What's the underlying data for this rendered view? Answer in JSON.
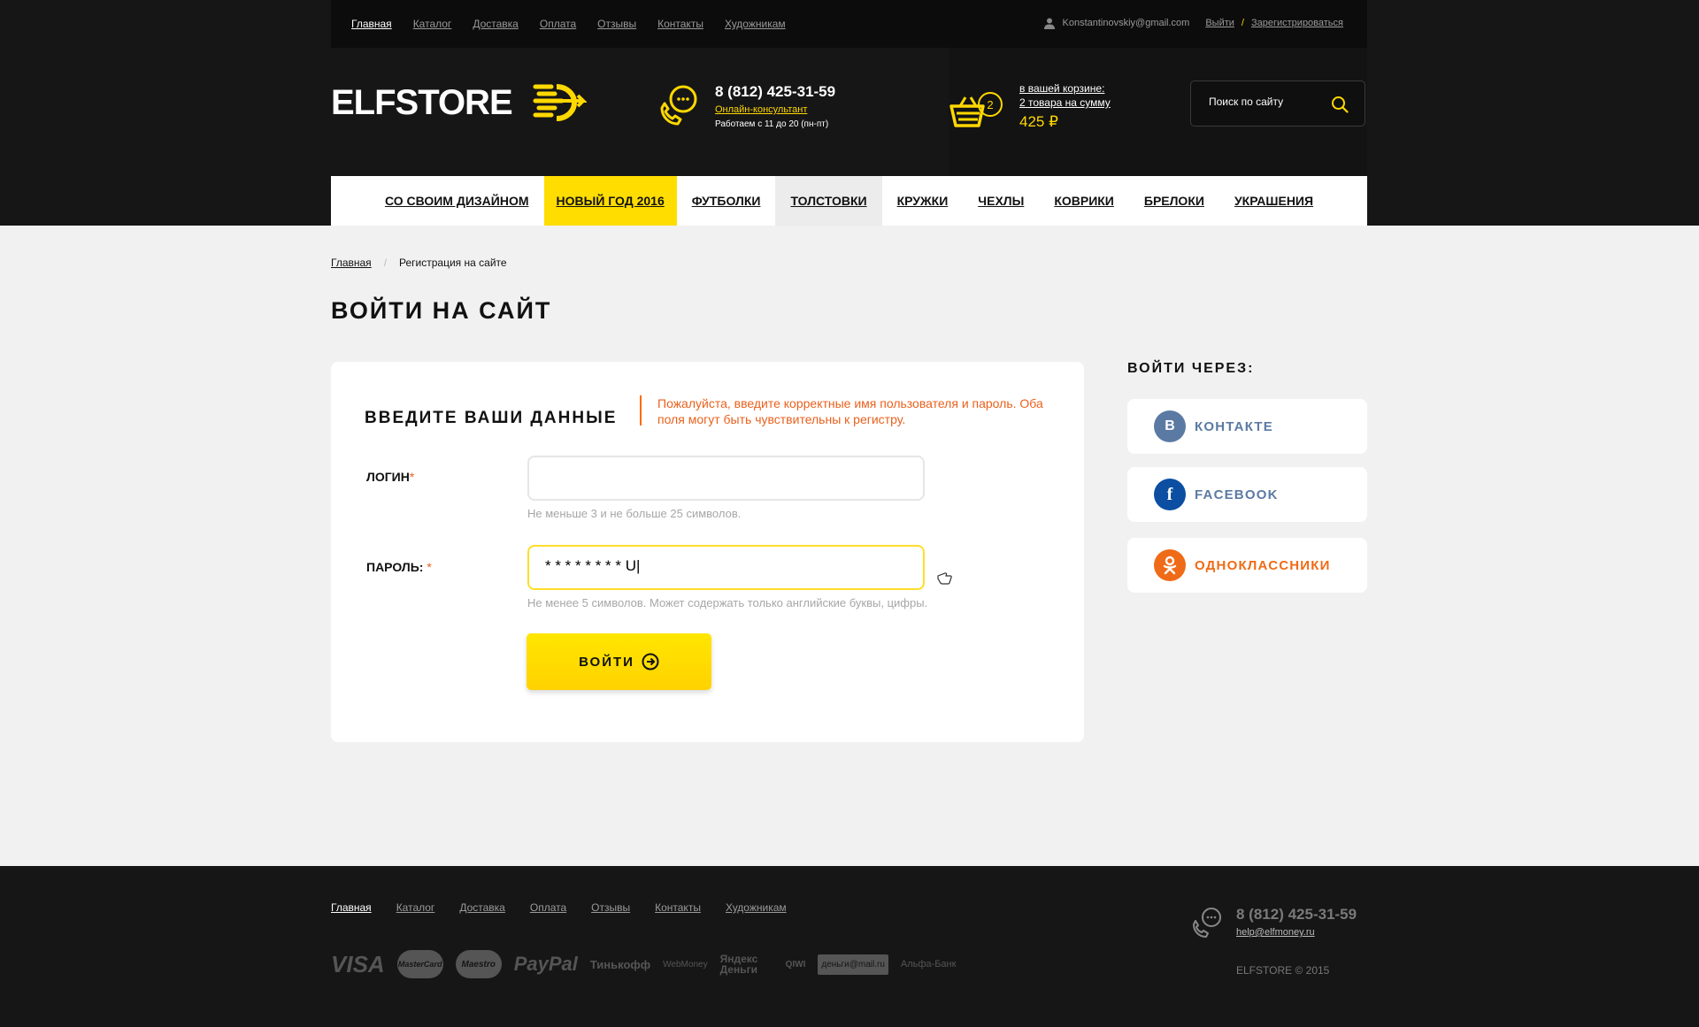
{
  "top_nav": {
    "items": [
      "Главная",
      "Каталог",
      "Доставка",
      "Оплата",
      "Отзывы",
      "Контакты",
      "Художникам"
    ],
    "active": "Главная"
  },
  "user": {
    "email": "Konstantinovskiy@gmail.com",
    "logout": "Выйти",
    "separator": "/",
    "register": "Зарегистрироваться"
  },
  "brand": {
    "name": "ELFSTORE",
    "accent": "#ffd800"
  },
  "contact": {
    "phone": "8 (812) 425-31-59",
    "consultant": "Онлайн-консультант",
    "hours": "Работаем с 11 до 20 (пн-пт)"
  },
  "cart": {
    "count": "2",
    "line1": "в вашей корзине:",
    "line2": "2 товара на сумму",
    "sum": "425 ₽"
  },
  "search": {
    "placeholder": "Поиск по сайту"
  },
  "categories": [
    "СО СВОИМ ДИЗАЙНОМ",
    "НОВЫЙ ГОД 2016",
    "ФУТБОЛКИ",
    "ТОЛСТОВКИ",
    "КРУЖКИ",
    "ЧЕХЛЫ",
    "КОВРИКИ",
    "БРЕЛОКИ",
    "УКРАШЕНИЯ"
  ],
  "breadcrumb": {
    "home": "Главная",
    "separator": "/",
    "current": "Регистрация на сайте"
  },
  "page_title": "ВОЙТИ НА САЙТ",
  "form": {
    "heading": "ВВЕДИТЕ ВАШИ ДАННЫЕ",
    "error": "Пожалуйста, введите корректные имя пользователя и пароль. Оба поля могут быть чувствительны к регистру.",
    "required_mark": "*",
    "login_label": "ЛОГИН",
    "login_value": "",
    "login_hint": "Не меньше 3 и не больше 25 символов.",
    "password_label": "ПАРОЛЬ:",
    "password_value": "* * * * * * * * U|",
    "password_hint": "Не менее 5 символов. Может содержать только английские буквы, цифры.",
    "submit": "ВОЙТИ"
  },
  "social": {
    "title": "ВОЙТИ ЧЕРЕЗ:",
    "items": [
      {
        "label": "КОНТАКТЕ",
        "letter": "В",
        "color": "#5b7aa3",
        "text_color": "#5b7aa3"
      },
      {
        "label": "FACEBOOK",
        "letter": "f",
        "color": "#0b4ea2",
        "text_color": "#5b7aa3"
      },
      {
        "label": "ОДНОКЛАССНИКИ",
        "letter": "ок",
        "color": "#ef6b17",
        "text_color": "#ef6b17"
      }
    ]
  },
  "footer": {
    "nav": [
      "Главная",
      "Каталог",
      "Доставка",
      "Оплата",
      "Отзывы",
      "Контакты",
      "Художникам"
    ],
    "payments": [
      "VISA",
      "MasterCard",
      "Maestro",
      "PayPal",
      "Тинькофф",
      "WebMoney",
      "Яндекс Деньги",
      "QIWI",
      "деньги@mail.ru",
      "Альфа-Банк"
    ],
    "phone": "8 (812) 425-31-59",
    "email": "help@elfmoney.ru",
    "copyright": "ELFSTORE © 2015"
  }
}
